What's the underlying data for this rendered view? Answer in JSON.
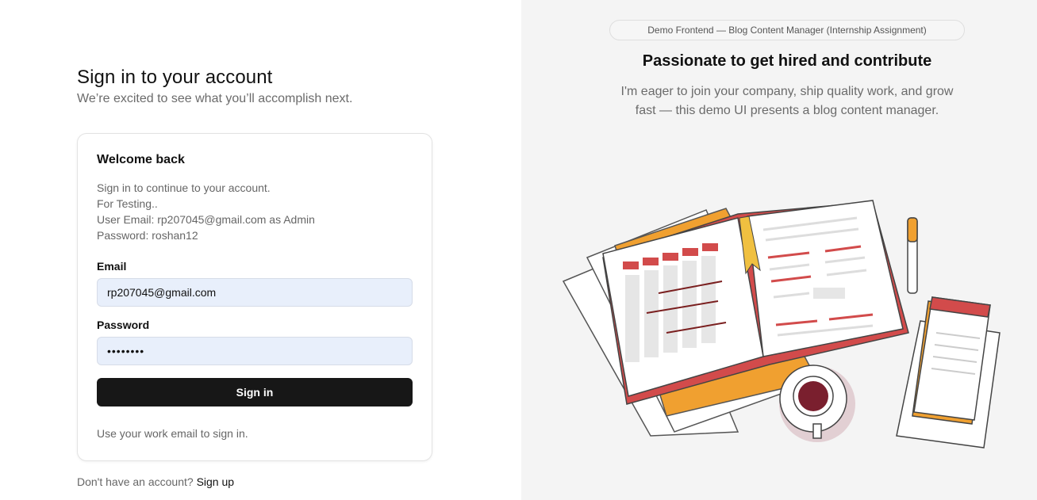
{
  "left": {
    "heading": "Sign in to your account",
    "subheading": "We’re excited to see what you’ll accomplish next.",
    "card": {
      "title": "Welcome back",
      "desc_lines": [
        "Sign in to continue to your account.",
        "For Testing..",
        "User Email: rp207045@gmail.com as Admin",
        "Password: roshan12"
      ],
      "email_label": "Email",
      "email_value": "rp207045@gmail.com",
      "password_label": "Password",
      "password_value": "roshan12",
      "submit_label": "Sign in",
      "hint": "Use your work email to sign in."
    },
    "signup_prompt": "Don't have an account?",
    "signup_link": "Sign up"
  },
  "right": {
    "badge": "Demo Frontend — Blog Content Manager (Internship Assignment)",
    "title": "Passionate to get hired and contribute",
    "desc_line1": "I'm eager to join your company, ship quality work, and grow",
    "desc_line2": "fast — this demo UI presents a blog content manager."
  },
  "colors": {
    "accent_red": "#d24b4b",
    "accent_orange": "#f0a030",
    "button": "#171717",
    "input_bg": "#e8effb"
  }
}
